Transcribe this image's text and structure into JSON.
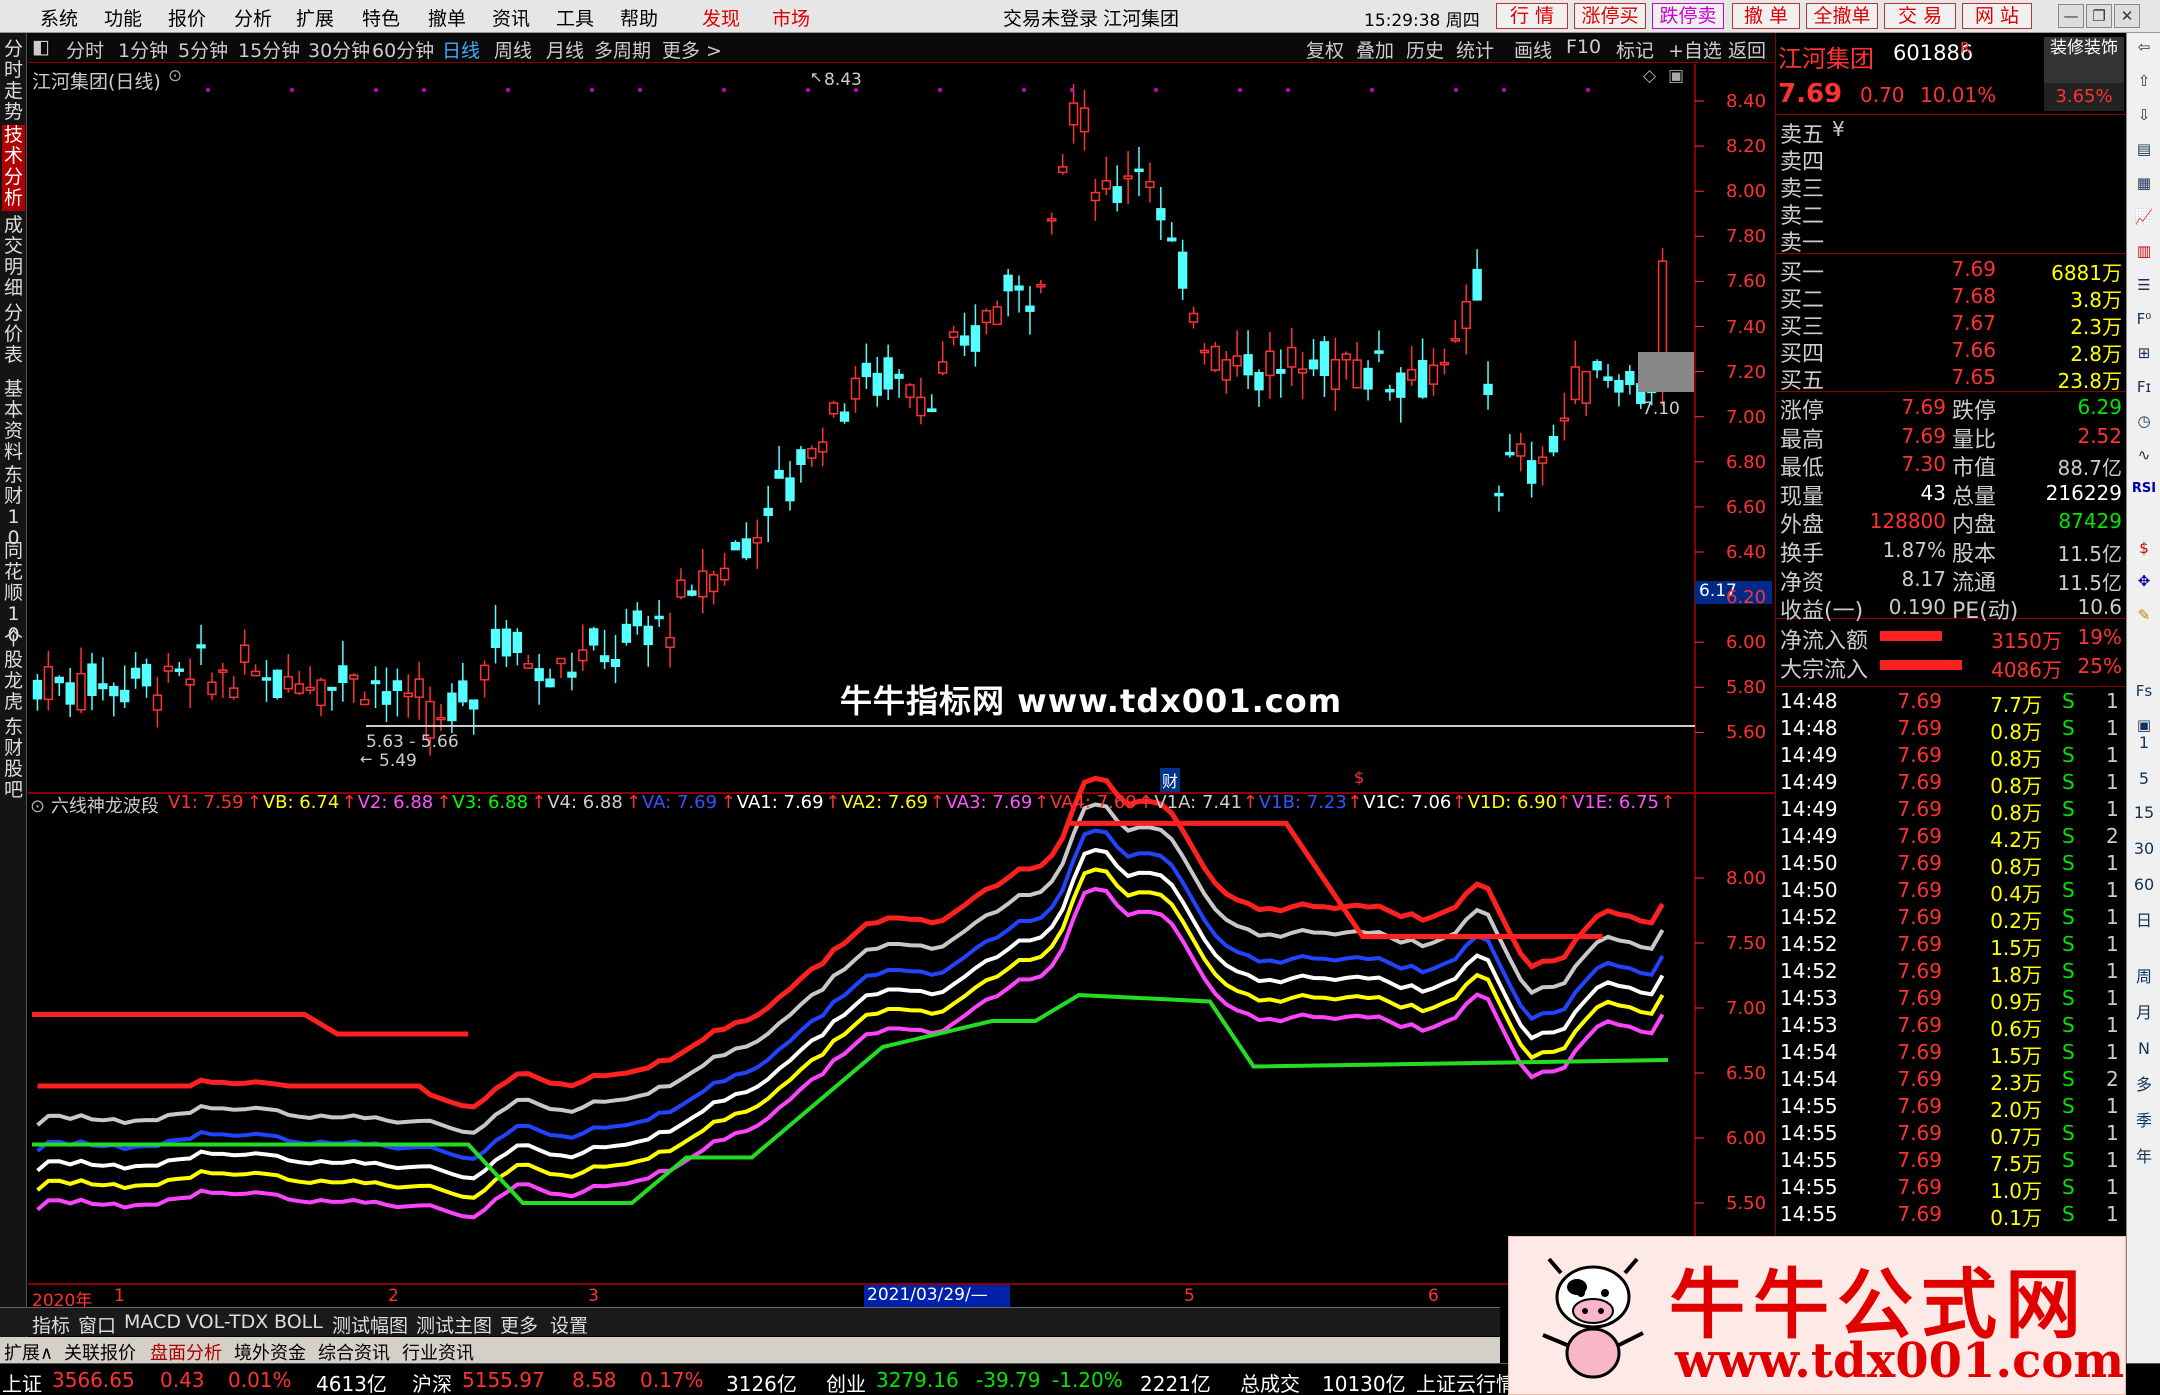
{
  "menu": {
    "items": [
      "系统",
      "功能",
      "报价",
      "分析",
      "扩展",
      "特色",
      "撤单",
      "资讯",
      "工具",
      "帮助"
    ],
    "discover": "发现",
    "market": "市场",
    "login_status": "交易未登录",
    "stock_name": "江河集团",
    "time": "15:29:38 周四",
    "trade_buttons": [
      "行 情",
      "涨停买",
      "跌停卖",
      "撤 单",
      "全撤单",
      "交 易",
      "网 站"
    ]
  },
  "left_tabs": [
    {
      "label": "分时走势",
      "active": false
    },
    {
      "label": "技术分析",
      "active": true
    },
    {
      "label": "成交明细",
      "active": false
    },
    {
      "label": "分价表",
      "active": false
    },
    {
      "label": "基本资料",
      "active": false
    },
    {
      "label": "东财10",
      "active": false
    },
    {
      "label": "同花顺10",
      "active": false
    },
    {
      "label": "个股龙虎",
      "active": false
    },
    {
      "label": "东财股吧",
      "active": false
    }
  ],
  "period_bar": {
    "items": [
      "分时",
      "1分钟",
      "5分钟",
      "15分钟",
      "30分钟",
      "60分钟",
      "日线",
      "周线",
      "月线",
      "多周期",
      "更多 >"
    ],
    "active": "日线",
    "right_items": [
      "复权",
      "叠加",
      "历史",
      "统计",
      "画线",
      "F10",
      "标记",
      "+自选",
      "返回"
    ]
  },
  "chart": {
    "title": "江河集团(日线)",
    "high_label": "8.43",
    "low_label": "5.49",
    "range_label": "5.63 - 5.66",
    "last_label": "7.10",
    "cursor_price": "6.17",
    "finance_marker": "财",
    "dollar_marker": "$",
    "price_axis": [
      "8.40",
      "8.20",
      "8.00",
      "7.80",
      "7.60",
      "7.40",
      "7.20",
      "7.00",
      "6.80",
      "6.60",
      "6.40",
      "6.20",
      "6.00",
      "5.80",
      "5.60"
    ],
    "ind_axis": [
      "8.00",
      "7.50",
      "7.00",
      "6.50",
      "6.00",
      "5.50"
    ],
    "date_axis": [
      "2020年",
      "1",
      "2",
      "3",
      "5",
      "6"
    ],
    "cursor_date": "2021/03/29/—"
  },
  "indicator": {
    "name": "六线神龙波段",
    "values": [
      {
        "label": "V1: 7.59",
        "color": "#ff3232"
      },
      {
        "label": "VB: 6.74",
        "color": "#ffff00"
      },
      {
        "label": "V2: 6.88",
        "color": "#ff55ff"
      },
      {
        "label": "V3: 6.88",
        "color": "#00ff00"
      },
      {
        "label": "V4: 6.88",
        "color": "#cccccc"
      },
      {
        "label": "VA: 7.69",
        "color": "#3355ff"
      },
      {
        "label": "VA1: 7.69",
        "color": "#ffffff"
      },
      {
        "label": "VA2: 7.69",
        "color": "#ffff00"
      },
      {
        "label": "VA3: 7.69",
        "color": "#ff55ff"
      },
      {
        "label": "VA4: 7.69",
        "color": "#ff3232"
      },
      {
        "label": "V1A: 7.41",
        "color": "#cccccc"
      },
      {
        "label": "V1B: 7.23",
        "color": "#3355ff"
      },
      {
        "label": "V1C: 7.06",
        "color": "#ffffff"
      },
      {
        "label": "V1D: 6.90",
        "color": "#ffff00"
      },
      {
        "label": "V1E: 6.75",
        "color": "#ff55ff"
      }
    ]
  },
  "watermark": "牛牛指标网 www.tdx001.com",
  "quote": {
    "name": "江河集团",
    "code": "601886",
    "r_tag": "R",
    "price": "7.69",
    "change": "0.70",
    "pct": "10.01%",
    "header_btn": "装修装饰",
    "header_pct": "3.65%",
    "asks": [
      {
        "label": "卖五",
        "mark": "¥"
      },
      {
        "label": "卖四",
        "mark": ""
      },
      {
        "label": "卖三",
        "mark": ""
      },
      {
        "label": "卖二",
        "mark": ""
      },
      {
        "label": "卖一",
        "mark": ""
      }
    ],
    "bids": [
      {
        "label": "买一",
        "price": "7.69",
        "vol": "6881万"
      },
      {
        "label": "买二",
        "price": "7.68",
        "vol": "3.8万"
      },
      {
        "label": "买三",
        "price": "7.67",
        "vol": "2.3万"
      },
      {
        "label": "买四",
        "price": "7.66",
        "vol": "2.8万"
      },
      {
        "label": "买五",
        "price": "7.65",
        "vol": "23.8万"
      }
    ],
    "stats": [
      {
        "l1": "涨停",
        "v1": "7.69",
        "c1": "red",
        "l2": "跌停",
        "v2": "6.29",
        "c2": "green"
      },
      {
        "l1": "最高",
        "v1": "7.69",
        "c1": "red",
        "l2": "量比",
        "v2": "2.52",
        "c2": "red"
      },
      {
        "l1": "最低",
        "v1": "7.30",
        "c1": "red",
        "l2": "市值",
        "v2": "88.7亿",
        "c2": "gray"
      },
      {
        "l1": "现量",
        "v1": "43",
        "c1": "white",
        "l2": "总量",
        "v2": "216229",
        "c2": "white"
      },
      {
        "l1": "外盘",
        "v1": "128800",
        "c1": "red",
        "l2": "内盘",
        "v2": "87429",
        "c2": "green"
      },
      {
        "l1": "换手",
        "v1": "1.87%",
        "c1": "gray",
        "l2": "股本",
        "v2": "11.5亿",
        "c2": "gray"
      },
      {
        "l1": "净资",
        "v1": "8.17",
        "c1": "gray",
        "l2": "流通",
        "v2": "11.5亿",
        "c2": "gray"
      },
      {
        "l1": "收益(一)",
        "v1": "0.190",
        "c1": "gray",
        "l2": "PE(动)",
        "v2": "10.6",
        "c2": "gray"
      }
    ],
    "flows": [
      {
        "label": "净流入额",
        "value": "3150万",
        "pct": "19%"
      },
      {
        "label": "大宗流入",
        "value": "4086万",
        "pct": "25%"
      }
    ],
    "ticks": [
      {
        "t": "14:48",
        "p": "7.69",
        "v": "7.7万",
        "s": "S",
        "n": "1"
      },
      {
        "t": "14:48",
        "p": "7.69",
        "v": "0.8万",
        "s": "S",
        "n": "1"
      },
      {
        "t": "14:49",
        "p": "7.69",
        "v": "0.8万",
        "s": "S",
        "n": "1"
      },
      {
        "t": "14:49",
        "p": "7.69",
        "v": "0.8万",
        "s": "S",
        "n": "1"
      },
      {
        "t": "14:49",
        "p": "7.69",
        "v": "0.8万",
        "s": "S",
        "n": "1"
      },
      {
        "t": "14:49",
        "p": "7.69",
        "v": "4.2万",
        "s": "S",
        "n": "2"
      },
      {
        "t": "14:50",
        "p": "7.69",
        "v": "0.8万",
        "s": "S",
        "n": "1"
      },
      {
        "t": "14:50",
        "p": "7.69",
        "v": "0.4万",
        "s": "S",
        "n": "1"
      },
      {
        "t": "14:52",
        "p": "7.69",
        "v": "0.2万",
        "s": "S",
        "n": "1"
      },
      {
        "t": "14:52",
        "p": "7.69",
        "v": "1.5万",
        "s": "S",
        "n": "1"
      },
      {
        "t": "14:52",
        "p": "7.69",
        "v": "1.8万",
        "s": "S",
        "n": "1"
      },
      {
        "t": "14:53",
        "p": "7.69",
        "v": "0.9万",
        "s": "S",
        "n": "1"
      },
      {
        "t": "14:53",
        "p": "7.69",
        "v": "0.6万",
        "s": "S",
        "n": "1"
      },
      {
        "t": "14:54",
        "p": "7.69",
        "v": "1.5万",
        "s": "S",
        "n": "1"
      },
      {
        "t": "14:54",
        "p": "7.69",
        "v": "2.3万",
        "s": "S",
        "n": "2"
      },
      {
        "t": "14:55",
        "p": "7.69",
        "v": "2.0万",
        "s": "S",
        "n": "1"
      },
      {
        "t": "14:55",
        "p": "7.69",
        "v": "0.7万",
        "s": "S",
        "n": "1"
      },
      {
        "t": "14:55",
        "p": "7.69",
        "v": "7.5万",
        "s": "S",
        "n": "1"
      },
      {
        "t": "14:55",
        "p": "7.69",
        "v": "1.0万",
        "s": "S",
        "n": "1"
      },
      {
        "t": "14:55",
        "p": "7.69",
        "v": "0.1万",
        "s": "S",
        "n": "1"
      }
    ]
  },
  "right_toolbar": [
    "RSI",
    "1",
    "5",
    "15",
    "30",
    "60",
    "日",
    "周",
    "月",
    "N",
    "多",
    "季",
    "年"
  ],
  "bottom_tabs": [
    "指标",
    "窗口",
    "MACD",
    "VOL-TDX",
    "BOLL",
    "测试幅图",
    "测试主图",
    "更多",
    "设置"
  ],
  "bottom_tabs2": [
    "扩展∧",
    "关联报价",
    "盘面分析",
    "境外资金",
    "综合资讯",
    "行业资讯"
  ],
  "status": {
    "sh_label": "上证",
    "sh_val": "3566.65",
    "sh_chg": "0.43",
    "sh_pct": "0.01%",
    "sh_amt": "4613亿",
    "sz_label": "沪深",
    "sz_val": "5155.97",
    "sz_chg": "8.58",
    "sz_pct": "0.17%",
    "sz_amt": "3126亿",
    "cy_label": "创业",
    "cy_val": "3279.16",
    "cy_chg": "-39.79",
    "cy_pct": "-1.20%",
    "cy_amt": "2221亿",
    "total_label": "总成交",
    "total_val": "10130亿",
    "tail": "上证云行情"
  },
  "ad": {
    "title": "牛牛公式网",
    "url": "www.tdx001.com"
  }
}
